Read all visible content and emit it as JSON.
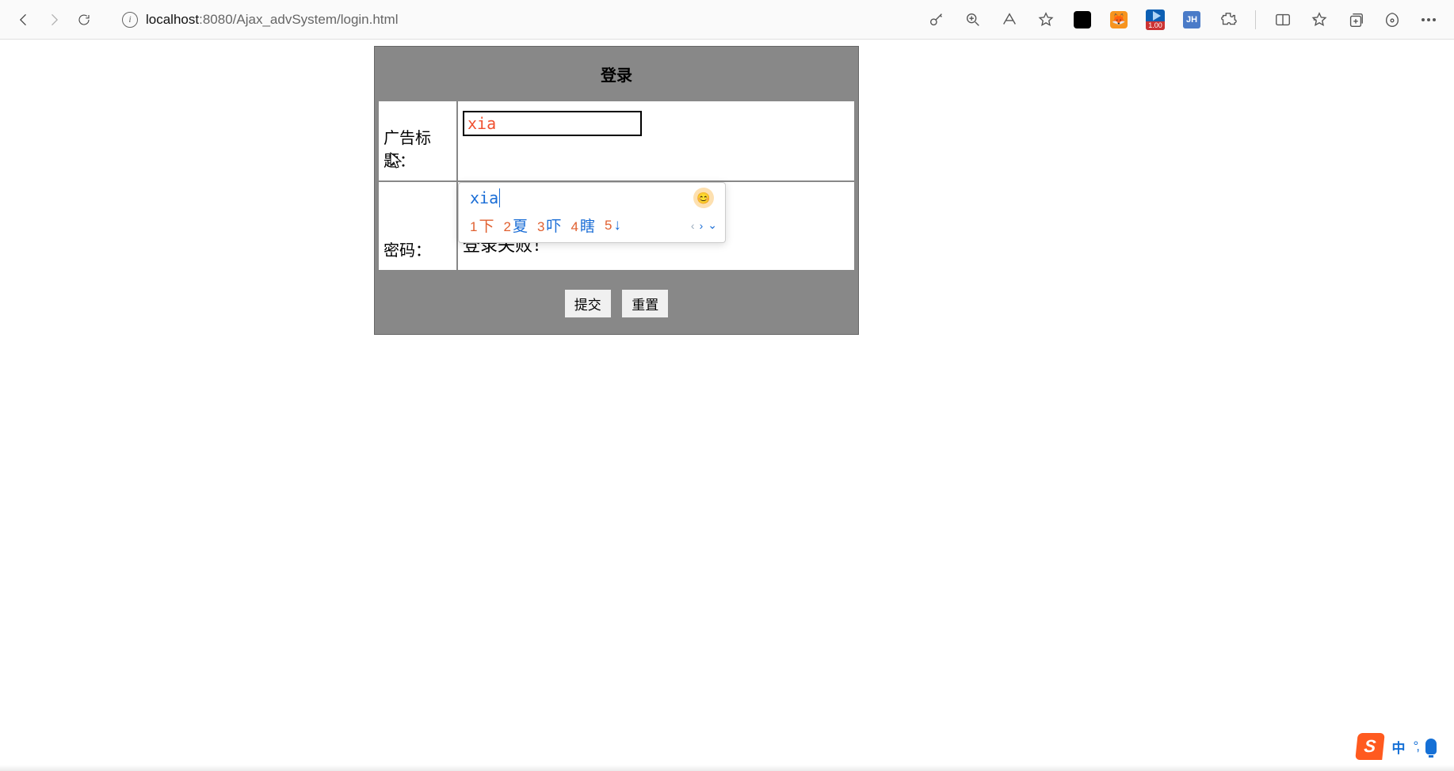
{
  "browser": {
    "url_host": "localhost",
    "url_port": ":8080",
    "url_path": "/Ajax_advSystem/login.html",
    "ext_blue_badge": "1.00",
    "ext_jh_label": "JH"
  },
  "page": {
    "title": "登录",
    "field1_label": "广告标题：",
    "field1_value": "xia",
    "field2_label": "密码：",
    "field2_value": "•••",
    "status_message": "登录失败！",
    "submit_label": "提交",
    "reset_label": "重置"
  },
  "ime": {
    "input": "xia",
    "candidates": [
      {
        "num": "1",
        "txt": "下"
      },
      {
        "num": "2",
        "txt": "夏"
      },
      {
        "num": "3",
        "txt": "吓"
      },
      {
        "num": "4",
        "txt": "瞎"
      },
      {
        "num": "5",
        "txt": "↓"
      }
    ]
  },
  "ime_taskbar": {
    "mode": "中",
    "punct": "°,"
  }
}
